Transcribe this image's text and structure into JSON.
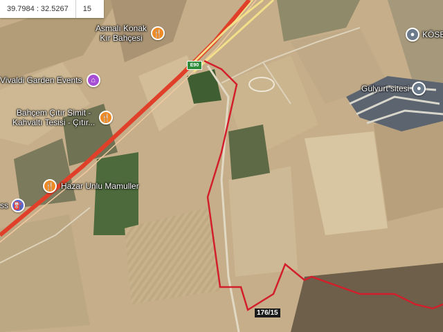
{
  "coordinates": {
    "value": "39.7984 : 32.5267",
    "zoom": "15"
  },
  "pois": [
    {
      "id": "asmali",
      "lines": [
        "Asmalı Konak",
        "Kır Bahçesi"
      ],
      "icon": "restaurant-icon",
      "color": "#f08a24"
    },
    {
      "id": "vivaldi",
      "lines": [
        "Vivaldi Garden Events"
      ],
      "icon": "event-venue-icon",
      "color": "#a64dd6"
    },
    {
      "id": "bahcem",
      "lines": [
        "Bahçem Çıtır Simit -",
        "Kahvaltı Tesisi - Çıtır..."
      ],
      "icon": "restaurant-icon",
      "color": "#f08a24"
    },
    {
      "id": "hazar",
      "lines": [
        "Hazar Unlu Mamuller"
      ],
      "icon": "restaurant-icon",
      "color": "#f08a24"
    },
    {
      "id": "gas",
      "lines": [
        "ss"
      ],
      "icon": "gas-station-icon",
      "color": "#5a67d8"
    },
    {
      "id": "gulyurt",
      "lines": [
        "Gülyurt sitesi"
      ],
      "icon": "location-pin-icon",
      "color": "#6b7b8c"
    },
    {
      "id": "kose",
      "lines": [
        "KÖSE"
      ],
      "icon": "location-pin-icon",
      "color": "#6b7b8c"
    }
  ],
  "road_shield": "E90",
  "plot_label": "176/15",
  "colors": {
    "boundary": "#d21f2b",
    "highway": "#e0402a",
    "field": "#c9b491"
  }
}
